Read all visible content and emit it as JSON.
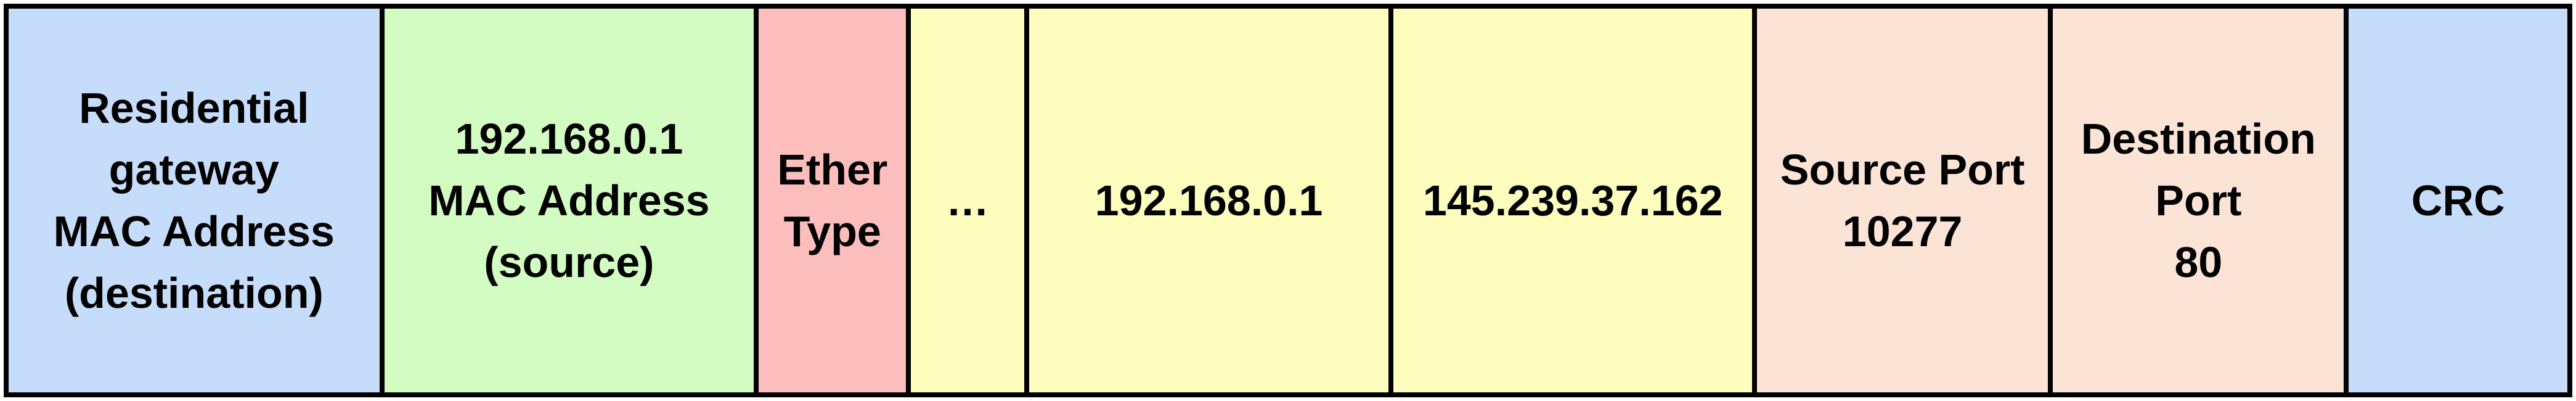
{
  "frame": {
    "fields": [
      {
        "lines": [
          "Residential",
          "gateway",
          "MAC Address",
          "(destination)"
        ],
        "color": "#c6dcfb"
      },
      {
        "lines": [
          "192.168.0.1",
          "MAC Address",
          "(source)"
        ],
        "color": "#d3fcc2"
      },
      {
        "lines": [
          "Ether",
          "Type"
        ],
        "color": "#fcbdbd"
      },
      {
        "lines": [
          "…"
        ],
        "color": "#fdfdbd"
      },
      {
        "lines": [
          "192.168.0.1"
        ],
        "color": "#fdfdbd"
      },
      {
        "lines": [
          "145.239.37.162"
        ],
        "color": "#fdfdbd"
      },
      {
        "lines": [
          "Source Port",
          "10277"
        ],
        "color": "#fbe3d6"
      },
      {
        "lines": [
          "Destination",
          "Port",
          "80"
        ],
        "color": "#fbe3d6"
      },
      {
        "lines": [
          "CRC"
        ],
        "color": "#c6dcfb"
      }
    ]
  }
}
